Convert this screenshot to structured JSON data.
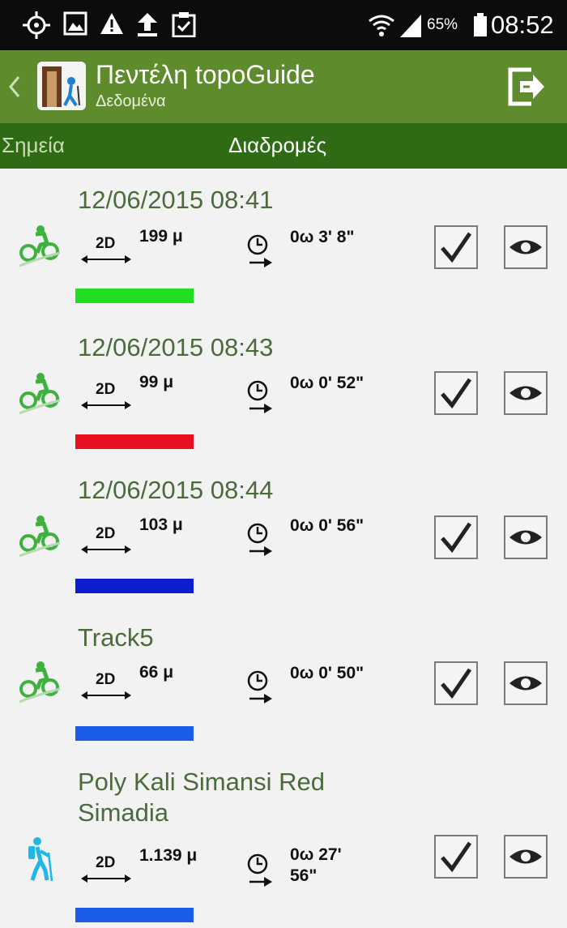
{
  "status_bar": {
    "battery": "65%",
    "time": "08:52",
    "icons": [
      "gps-icon",
      "image-icon",
      "warning-icon",
      "upload-icon",
      "clipboard-icon",
      "wifi-icon",
      "signal-icon",
      "battery-icon"
    ]
  },
  "action_bar": {
    "title": "Πεντέλη topoGuide",
    "subtitle": "Δεδομένα",
    "icons": [
      "back-chevron-icon",
      "app-logo-icon",
      "export-icon"
    ]
  },
  "tabs": [
    {
      "label": "Σημεία",
      "selected": false
    },
    {
      "label": "Διαδρομές",
      "selected": true
    }
  ],
  "mode_label": "2D",
  "routes": [
    {
      "title": "12/06/2015 08:41",
      "activity": "cycling-icon",
      "distance": "199 μ",
      "duration": "0ω 3' 8\"",
      "color": "#22dd22"
    },
    {
      "title": "12/06/2015 08:43",
      "activity": "cycling-icon",
      "distance": "99 μ",
      "duration": "0ω 0' 52\"",
      "color": "#e81020"
    },
    {
      "title": "12/06/2015 08:44",
      "activity": "cycling-icon",
      "distance": "103 μ",
      "duration": "0ω 0' 56\"",
      "color": "#0a1ed0"
    },
    {
      "title": "Track5",
      "activity": "cycling-icon",
      "distance": "66 μ",
      "duration": "0ω 0' 50\"",
      "color": "#1a5ee8"
    },
    {
      "title_line1": "Poly Kali Simansi Red",
      "title_line2": "Simadia",
      "activity": "hiking-icon",
      "distance": "1.139 μ",
      "duration_line1": "0ω 27'",
      "duration_line2": "56\"",
      "color": "#1a5ee8"
    }
  ],
  "colors": {
    "action_bar": "#5e8b2b",
    "tab_bar": "#2f6a14",
    "title_text": "#4b6b3d",
    "cycling_icon": "#3db33d",
    "hiking_icon": "#1fb6e8"
  }
}
